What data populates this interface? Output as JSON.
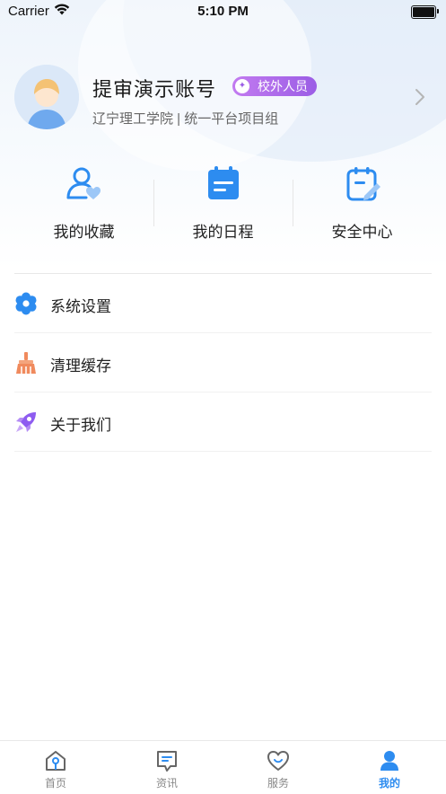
{
  "status_bar": {
    "carrier": "Carrier",
    "time": "5:10 PM"
  },
  "profile": {
    "name": "提审演示账号",
    "role_badge": "校外人员",
    "subtitle": "辽宁理工学院 | 统一平台项目组"
  },
  "quick_actions": [
    {
      "label": "我的收藏",
      "icon": "user-favorite-icon"
    },
    {
      "label": "我的日程",
      "icon": "calendar-icon"
    },
    {
      "label": "安全中心",
      "icon": "security-clipboard-icon"
    }
  ],
  "menu": [
    {
      "label": "系统设置",
      "icon": "settings-flower-icon"
    },
    {
      "label": "清理缓存",
      "icon": "broom-icon"
    },
    {
      "label": "关于我们",
      "icon": "rocket-icon"
    }
  ],
  "tabs": [
    {
      "label": "首页",
      "icon": "home-icon",
      "active": false
    },
    {
      "label": "资讯",
      "icon": "message-icon",
      "active": false
    },
    {
      "label": "服务",
      "icon": "heart-icon",
      "active": false
    },
    {
      "label": "我的",
      "icon": "user-icon",
      "active": true
    }
  ],
  "colors": {
    "accent": "#2d8cf0",
    "badge": "#a567ea",
    "text": "#222222",
    "muted": "#888888"
  }
}
